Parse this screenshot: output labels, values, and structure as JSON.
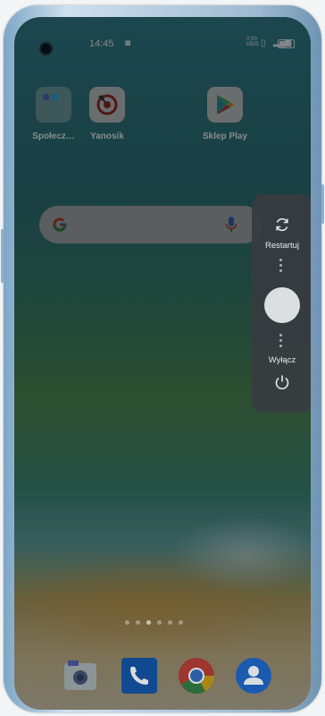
{
  "status_bar": {
    "time": "14:45",
    "network_speed": "0,00\nKB/S"
  },
  "home_apps": [
    {
      "label": "Społecz…",
      "icon": "social-folder-icon"
    },
    {
      "label": "Yanosik",
      "icon": "yanosik-icon"
    },
    {
      "label": "Sklep Play",
      "icon": "play-store-icon"
    }
  ],
  "search_widget": {
    "icon": "google-icon",
    "mic": "microphone-icon"
  },
  "power_menu": {
    "restart_label": "Restartuj",
    "shutdown_label": "Wyłącz",
    "restart_icon": "refresh-icon",
    "shutdown_icon": "power-icon"
  },
  "dock": [
    {
      "icon": "camera-icon"
    },
    {
      "icon": "phone-icon"
    },
    {
      "icon": "chrome-icon"
    },
    {
      "icon": "contacts-icon"
    }
  ],
  "colors": {
    "accent_blue": "#1f6fd1",
    "google_red": "#ea4335",
    "google_yellow": "#fbbc05",
    "google_green": "#34a853",
    "google_blue": "#4285f4"
  }
}
